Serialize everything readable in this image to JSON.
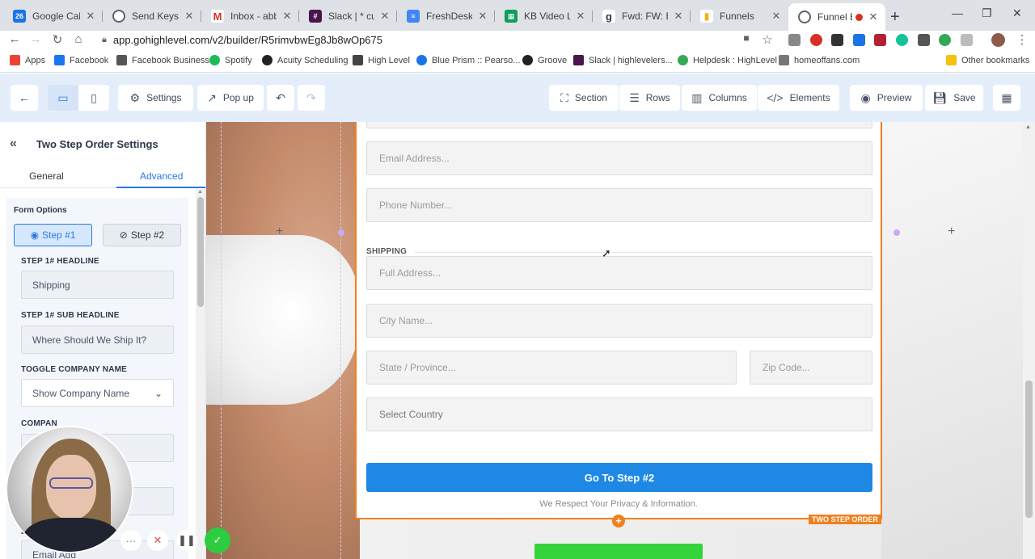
{
  "browser": {
    "tabs": [
      {
        "title": "Google Calendar",
        "icon": "calendar-icon",
        "color": "#1a73e8",
        "badge": "26"
      },
      {
        "title": "Send Keys and",
        "icon": "globe-icon",
        "color": "#5f6368",
        "badge": ""
      },
      {
        "title": "Inbox - abby@",
        "icon": "gmail-icon",
        "color": "#d93025",
        "badge": "M"
      },
      {
        "title": "Slack | * custo",
        "icon": "slack-icon",
        "color": "#4a154b",
        "badge": ""
      },
      {
        "title": "FreshDesk Tran",
        "icon": "docs-icon",
        "color": "#4285f4",
        "badge": ""
      },
      {
        "title": "KB Video List -",
        "icon": "sheets-icon",
        "color": "#0f9d58",
        "badge": ""
      },
      {
        "title": "Fwd: FW: Book",
        "icon": "groove-icon",
        "color": "#333333",
        "badge": ""
      },
      {
        "title": "Funnels",
        "icon": "bar-chart-icon",
        "color": "#f4b400",
        "badge": ""
      },
      {
        "title": "Funnel Bu",
        "icon": "globe-icon",
        "color": "#5f6368",
        "badge": ""
      }
    ],
    "url": "app.gohighlevel.com/v2/builder/R5rimvbwEg8Jb8wOp675",
    "bookmarks": [
      {
        "label": "Apps",
        "color": "#ea4335"
      },
      {
        "label": "Facebook",
        "color": "#1877f2"
      },
      {
        "label": "Facebook Business",
        "color": "#555555"
      },
      {
        "label": "Spotify",
        "color": "#1db954"
      },
      {
        "label": "Acuity Scheduling",
        "color": "#222222"
      },
      {
        "label": "High Level",
        "color": "#444444"
      },
      {
        "label": "Blue Prism :: Pearso...",
        "color": "#1a73e8"
      },
      {
        "label": "Groove",
        "color": "#222222"
      },
      {
        "label": "Slack | highlevelers...",
        "color": "#4a154b"
      },
      {
        "label": "Helpdesk : HighLevel",
        "color": "#34a853"
      },
      {
        "label": "homeoffans.com",
        "color": "#777777"
      },
      {
        "label": "Other bookmarks",
        "color": "#f4c20d"
      }
    ]
  },
  "toolbar": {
    "settings": "Settings",
    "popup": "Pop up",
    "section": "Section",
    "rows": "Rows",
    "columns": "Columns",
    "elements": "Elements",
    "preview": "Preview",
    "save": "Save"
  },
  "panel": {
    "title": "Two Step Order Settings",
    "tabs": {
      "general": "General",
      "advanced": "Advanced"
    },
    "form_options": "Form Options",
    "step1": "Step #1",
    "step2": "Step #2",
    "step1_headline_label": "STEP 1# HEADLINE",
    "step1_headline_value": "Shipping",
    "step1_sub_label": "STEP 1# SUB HEADLINE",
    "step1_sub_value": "Where Should We Ship It?",
    "toggle_company_label": "TOGGLE COMPANY NAME",
    "toggle_company_value": "Show Company Name",
    "company_label_partial": "COMPAN",
    "email_label_partial": "EM",
    "email_value_partial": "Email Add"
  },
  "form": {
    "email_placeholder": "Email Address...",
    "phone_placeholder": "Phone Number...",
    "shipping_heading": "SHIPPING",
    "address_placeholder": "Full Address...",
    "city_placeholder": "City Name...",
    "state_placeholder": "State / Province...",
    "zip_placeholder": "Zip Code...",
    "country_placeholder": "Select Country",
    "cta": "Go To Step #2",
    "privacy": "We Respect Your Privacy & Information.",
    "tag": "TWO STEP ORDER"
  },
  "colors": {
    "accent_blue": "#1e88e5",
    "form_border": "#f0801d",
    "toolbar_bg": "#e4eefb",
    "green_button": "#35d43a"
  }
}
